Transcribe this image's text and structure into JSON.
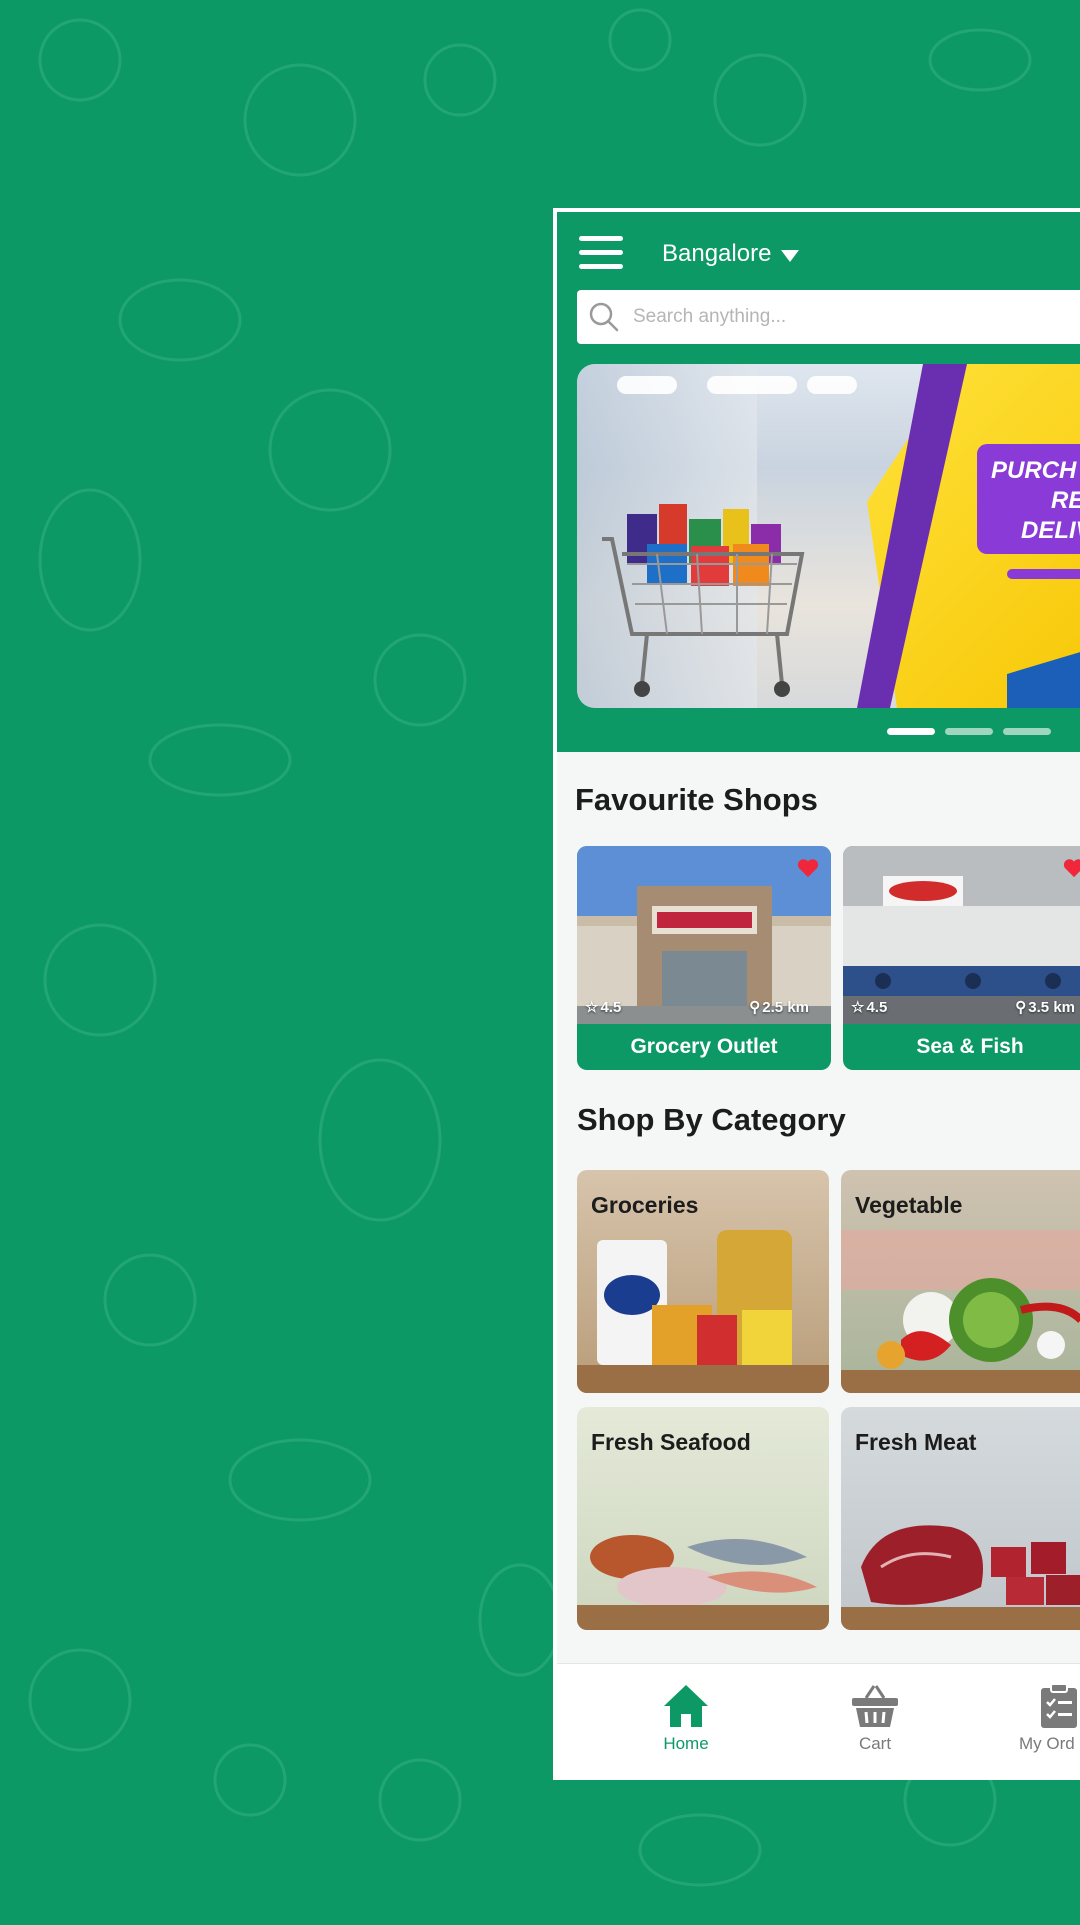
{
  "app": {
    "location": "Bangalore",
    "search_placeholder": "Search anything..."
  },
  "banner": {
    "promo_lines": [
      "PURCH",
      "RE",
      "DELIV"
    ],
    "slide_count": 3,
    "active_slide": 1
  },
  "favourite_shops": {
    "title": "Favourite Shops",
    "items": [
      {
        "name": "Grocery Outlet",
        "rating": "4.5",
        "distance": "2.5 km",
        "favourite": true
      },
      {
        "name": "Sea & Fish",
        "rating": "4.5",
        "distance": "3.5 km",
        "favourite": true
      }
    ]
  },
  "categories": {
    "title": "Shop By Category",
    "items": [
      {
        "label": "Groceries"
      },
      {
        "label": "Vegetable"
      },
      {
        "label": "Fresh Seafood"
      },
      {
        "label": "Fresh Meat"
      }
    ]
  },
  "bottom_nav": {
    "items": [
      {
        "label": "Home",
        "icon": "home-icon",
        "active": true
      },
      {
        "label": "Cart",
        "icon": "basket-icon",
        "active": false
      },
      {
        "label": "My Ord",
        "icon": "clipboard-check-icon",
        "active": false
      }
    ]
  },
  "colors": {
    "brand": "#0d9966",
    "favourite": "#f0263a",
    "inactive": "#7a7a7a"
  }
}
